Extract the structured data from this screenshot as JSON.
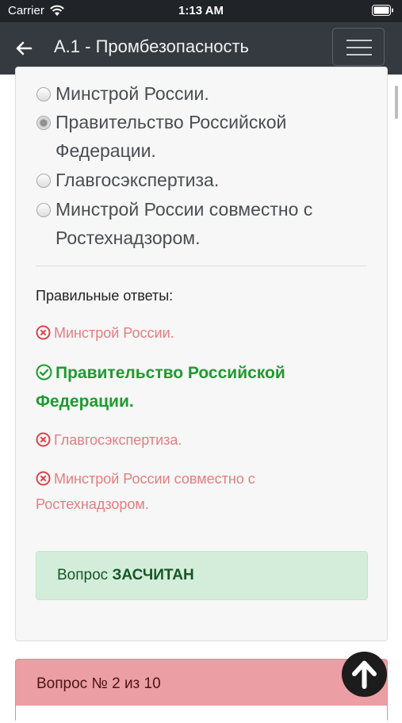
{
  "status_bar": {
    "carrier": "Carrier",
    "time": "1:13 AM"
  },
  "navbar": {
    "title": "А.1 - Промбезопасность"
  },
  "question": {
    "options": [
      {
        "label": "Минстрой России.",
        "checked": false
      },
      {
        "label": "Правительство Российской Федерации.",
        "checked": true
      },
      {
        "label": "Главгосэкспертиза.",
        "checked": false
      },
      {
        "label": "Минстрой России совместно с Ростехнадзором.",
        "checked": false
      }
    ]
  },
  "answers": {
    "title": "Правильные ответы:",
    "items": [
      {
        "label": "Минстрой России.",
        "correct": false
      },
      {
        "label": "Правительство Российской Федерации.",
        "correct": true
      },
      {
        "label": "Главгосэкспертиза.",
        "correct": false
      },
      {
        "label": "Минстрой России совместно с Ростехнадзором.",
        "correct": false
      }
    ]
  },
  "verdict": {
    "prefix": "Вопрос",
    "status": "ЗАСЧИТАН"
  },
  "next_question": {
    "label": "Вопрос № 2 из 10"
  },
  "colors": {
    "correct": "#1f9a2f",
    "wrong": "#e57d80",
    "verdict_bg": "#d4edda",
    "next_bg": "#eb9ea3",
    "navbar": "#343a40"
  }
}
